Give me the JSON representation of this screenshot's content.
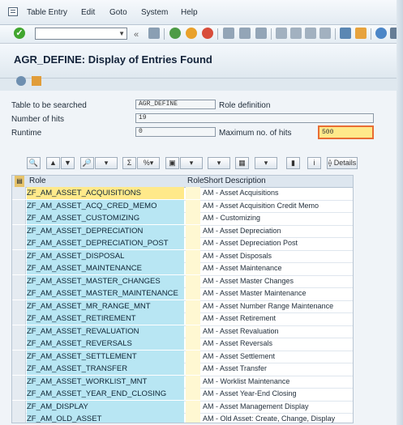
{
  "menu": {
    "items": [
      "Table Entry",
      "Edit",
      "Goto",
      "System",
      "Help"
    ]
  },
  "toolbar": {
    "command_field": ""
  },
  "page": {
    "title": "AGR_DEFINE: Display of Entries Found"
  },
  "search": {
    "table_label": "Table to be searched",
    "table_value": "AGR_DEFINE",
    "table_desc": "Role definition",
    "hits_label": "Number of hits",
    "hits_value": "19",
    "runtime_label": "Runtime",
    "runtime_value": "0",
    "max_hits_label": "Maximum no. of hits",
    "max_hits_value": "500"
  },
  "alv_toolbar": {
    "details_label": "Details"
  },
  "grid": {
    "headers": [
      "Role",
      "Role",
      "Short Description"
    ],
    "rows": [
      {
        "role": "ZF_AM_ASSET_ACQUISITIONS",
        "desc": "AM - Asset Acquisitions"
      },
      {
        "role": "ZF_AM_ASSET_ACQ_CRED_MEMO",
        "desc": "AM - Asset Acquisition Credit Memo"
      },
      {
        "role": "ZF_AM_ASSET_CUSTOMIZING",
        "desc": "AM - Customizing"
      },
      {
        "role": "ZF_AM_ASSET_DEPRECIATION",
        "desc": "AM - Asset Depreciation"
      },
      {
        "role": "ZF_AM_ASSET_DEPRECIATION_POST",
        "desc": "AM - Asset Depreciation Post"
      },
      {
        "role": "ZF_AM_ASSET_DISPOSAL",
        "desc": "AM - Asset Disposals"
      },
      {
        "role": "ZF_AM_ASSET_MAINTENANCE",
        "desc": "AM - Asset Maintenance"
      },
      {
        "role": "ZF_AM_ASSET_MASTER_CHANGES",
        "desc": "AM - Asset Master Changes"
      },
      {
        "role": "ZF_AM_ASSET_MASTER_MAINTENANCE",
        "desc": "AM - Asset Master Maintenance"
      },
      {
        "role": "ZF_AM_ASSET_MR_RANGE_MNT",
        "desc": "AM - Asset Number Range Maintenance"
      },
      {
        "role": "ZF_AM_ASSET_RETIREMENT",
        "desc": "AM - Asset Retirement"
      },
      {
        "role": "ZF_AM_ASSET_REVALUATION",
        "desc": "AM - Asset Revaluation"
      },
      {
        "role": "ZF_AM_ASSET_REVERSALS",
        "desc": "AM - Asset Reversals"
      },
      {
        "role": "ZF_AM_ASSET_SETTLEMENT",
        "desc": "AM - Asset Settlement"
      },
      {
        "role": "ZF_AM_ASSET_TRANSFER",
        "desc": "AM - Asset Transfer"
      },
      {
        "role": "ZF_AM_ASSET_WORKLIST_MNT",
        "desc": "AM - Worklist Maintenance"
      },
      {
        "role": "ZF_AM_ASSET_YEAR_END_CLOSING",
        "desc": "AM - Asset Year-End Closing"
      },
      {
        "role": "ZF_AM_DISPLAY",
        "desc": "AM - Asset Management Display"
      },
      {
        "role": "ZF_AM_OLD_ASSET",
        "desc": "AM - Old Asset: Create, Change, Display"
      }
    ]
  }
}
